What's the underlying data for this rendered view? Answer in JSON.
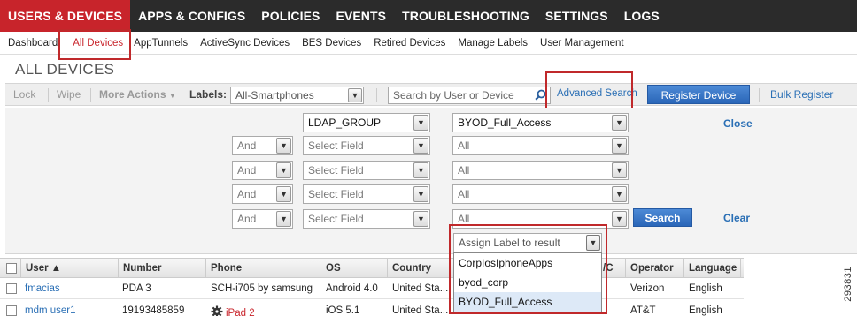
{
  "topnav": {
    "tabs": [
      {
        "label": "USERS & DEVICES",
        "active": true
      },
      {
        "label": "APPS & CONFIGS"
      },
      {
        "label": "POLICIES"
      },
      {
        "label": "EVENTS"
      },
      {
        "label": "TROUBLESHOOTING"
      },
      {
        "label": "SETTINGS"
      },
      {
        "label": "LOGS"
      }
    ]
  },
  "subnav": {
    "items": [
      {
        "label": "Dashboard"
      },
      {
        "label": "All Devices",
        "active": true
      },
      {
        "label": "AppTunnels"
      },
      {
        "label": "ActiveSync Devices"
      },
      {
        "label": "BES Devices"
      },
      {
        "label": "Retired Devices"
      },
      {
        "label": "Manage Labels"
      },
      {
        "label": "User Management"
      }
    ]
  },
  "page_title": "ALL DEVICES",
  "toolbar": {
    "lock": "Lock",
    "wipe": "Wipe",
    "more_actions": "More Actions",
    "labels_label": "Labels:",
    "labels_value": "All-Smartphones",
    "search_placeholder": "Search by User or Device",
    "advanced_search": "Advanced Search",
    "register_device": "Register Device",
    "bulk_register": "Bulk Register"
  },
  "filter": {
    "first_field": "LDAP_GROUP",
    "first_value": "BYOD_Full_Access",
    "close": "Close",
    "rows": [
      {
        "op": "And",
        "field": "Select Field",
        "value": "All"
      },
      {
        "op": "And",
        "field": "Select Field",
        "value": "All"
      },
      {
        "op": "And",
        "field": "Select Field",
        "value": "All"
      },
      {
        "op": "And",
        "field": "Select Field",
        "value": "All"
      }
    ],
    "search": "Search",
    "clear": "Clear"
  },
  "assign_label": {
    "placeholder": "Assign Label to result",
    "options": [
      "CorpIosIphoneApps",
      "byod_corp",
      "BYOD_Full_Access"
    ],
    "selected_index": 2
  },
  "table": {
    "headers": [
      "User ▲",
      "Number",
      "Phone",
      "OS",
      "Country",
      "/C",
      "Operator",
      "Language"
    ],
    "rows": [
      {
        "user": "fmacias",
        "number": "PDA 3",
        "phone": "SCH-i705 by samsung",
        "os": "Android 4.0",
        "country": "United Sta...",
        "operator": "Verizon",
        "language": "English"
      },
      {
        "user": "mdm user1",
        "number": "19193485859",
        "phone": "iPad 2",
        "os": "iOS 5.1",
        "country": "United Sta...",
        "operator": "AT&T",
        "language": "English"
      }
    ]
  },
  "figure_number": "293831",
  "colors": {
    "accent_red": "#c8242b",
    "link_blue": "#2a6fb5",
    "highlight_border": "#c0292b"
  }
}
